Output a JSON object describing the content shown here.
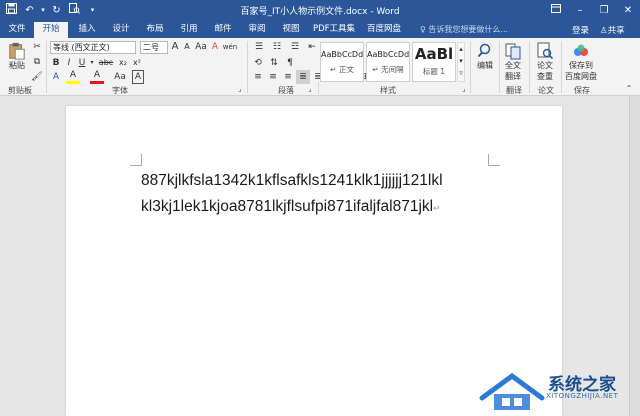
{
  "window": {
    "title": "百家号_IT小人物示例文件.docx - Word"
  },
  "qat": {
    "save_icon": "save-icon",
    "undo_icon": "undo-icon",
    "redo_icon": "redo-icon",
    "customize_icon": "chevron-down-icon"
  },
  "tabs": [
    {
      "label": "文件"
    },
    {
      "label": "开始"
    },
    {
      "label": "插入"
    },
    {
      "label": "设计"
    },
    {
      "label": "布局"
    },
    {
      "label": "引用"
    },
    {
      "label": "邮件"
    },
    {
      "label": "审阅"
    },
    {
      "label": "视图"
    },
    {
      "label": "PDF工具集"
    },
    {
      "label": "百度网盘"
    }
  ],
  "tellme": {
    "placeholder": "告诉我您想要做什么..."
  },
  "account": {
    "login": "登录",
    "share": "共享"
  },
  "ribbon": {
    "clipboard": {
      "paste": "粘贴",
      "label": "剪贴板"
    },
    "font": {
      "name": "等线 (西文正文)",
      "size": "二号",
      "label": "字体",
      "grow": "A",
      "shrink": "A",
      "case": "Aa",
      "clear": "A",
      "wen": "wén",
      "bold": "B",
      "italic": "I",
      "underline": "U",
      "strike": "abc",
      "sub": "x₂",
      "sup": "x²",
      "effects": "A",
      "highlight": "A",
      "color": "A",
      "size_aa": "Aa",
      "char_border": "A"
    },
    "paragraph": {
      "label": "段落"
    },
    "styles": {
      "label": "样式",
      "items": [
        {
          "sample": "AaBbCcDd",
          "name": "正文"
        },
        {
          "sample": "AaBbCcDd",
          "name": "无间隔"
        },
        {
          "sample": "AaBl",
          "name": "标题 1"
        }
      ]
    },
    "editing": {
      "button": "编辑"
    },
    "translate": {
      "button_line1": "全文",
      "button_line2": "翻译",
      "label": "翻译"
    },
    "paper": {
      "button_line1": "论文",
      "button_line2": "查重",
      "label": "论文"
    },
    "save": {
      "button_line1": "保存到",
      "button_line2": "百度网盘",
      "label": "保存"
    }
  },
  "document": {
    "line1": "887kjlkfsla1342k1kflsafkls1241klk1jjjjjj121lkl",
    "line2": "kl3kj1lek1kjoa8781lkjflsufpi871ifaljfal871jkl"
  },
  "watermark": {
    "text": "系统之家",
    "sub": "XITONGZHIJIA.NET"
  },
  "colors": {
    "brand": "#2b579a",
    "ribbon": "#f3f3f3",
    "workspace": "#e6e6e6",
    "font_red": "#e81123"
  }
}
